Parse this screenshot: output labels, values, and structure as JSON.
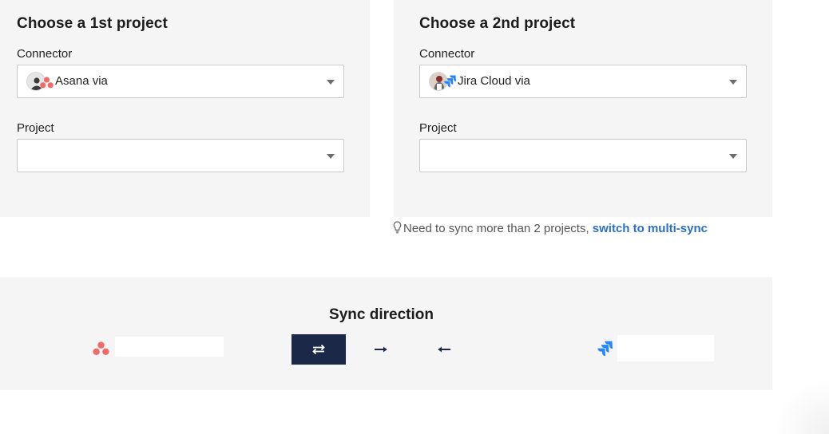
{
  "project1": {
    "title": "Choose a 1st project",
    "connector_label": "Connector",
    "connector_value": "Asana via",
    "project_label": "Project",
    "project_value": ""
  },
  "project2": {
    "title": "Choose a 2nd project",
    "connector_label": "Connector",
    "connector_value": "Jira Cloud via",
    "project_label": "Project",
    "project_value": ""
  },
  "hint": {
    "text": "Need to sync more than 2 projects,",
    "link": "switch to multi-sync"
  },
  "sync": {
    "title": "Sync direction",
    "left_project_name": "",
    "right_project_name": "",
    "selected_direction": "two-way"
  },
  "icons": {
    "connector1": "asana-icon",
    "connector2": "jira-icon",
    "hint": "lightbulb-icon",
    "two_way": "two-way-arrows-icon",
    "right": "arrow-right-icon",
    "left": "arrow-left-icon"
  },
  "colors": {
    "asana": "#f06a6a",
    "jira": "#2684ff",
    "link": "#2a6fc9",
    "active_direction": "#1b2847",
    "panel_bg": "#f5f5f5"
  }
}
